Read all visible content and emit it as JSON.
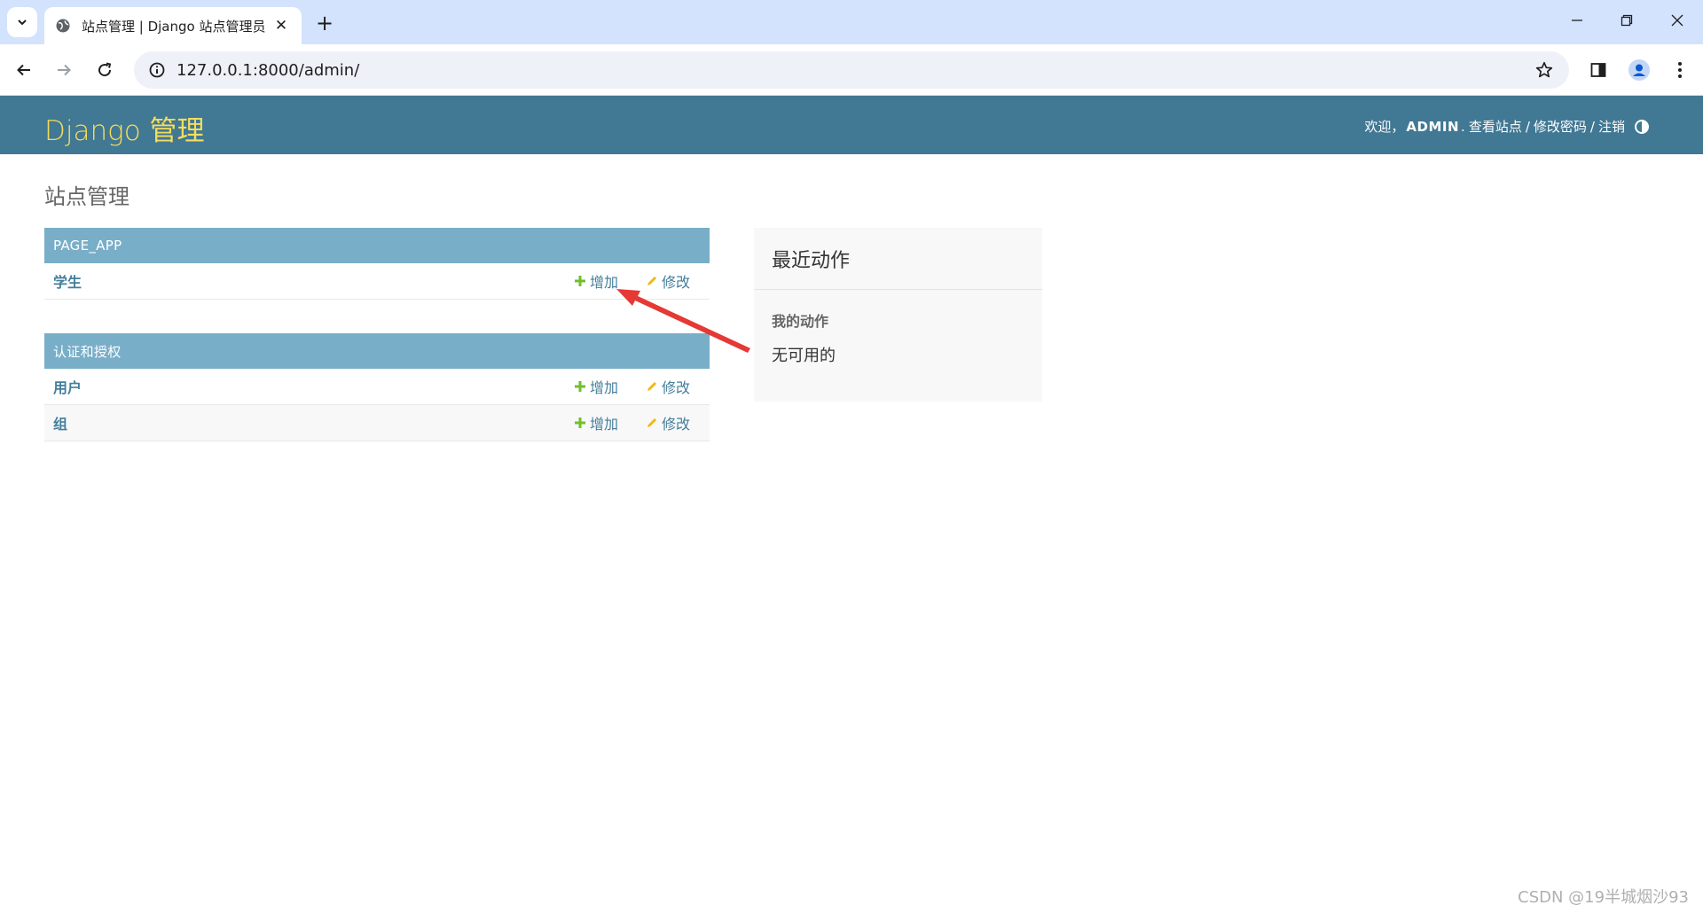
{
  "browser": {
    "tab_title": "站点管理 | Django 站点管理员",
    "url": "127.0.0.1:8000/admin/",
    "close_glyph": "✕",
    "new_tab_glyph": "+"
  },
  "header": {
    "branding": "Django 管理",
    "welcome": "欢迎，",
    "username": "ADMIN",
    "dot": ".",
    "view_site": "查看站点",
    "sep": "/",
    "change_password": "修改密码",
    "logout": "注销"
  },
  "content": {
    "title": "站点管理"
  },
  "apps": [
    {
      "caption": "PAGE_APP",
      "models": [
        {
          "name": "学生",
          "add": "增加",
          "change": "修改"
        }
      ]
    },
    {
      "caption": "认证和授权",
      "models": [
        {
          "name": "用户",
          "add": "增加",
          "change": "修改"
        },
        {
          "name": "组",
          "add": "增加",
          "change": "修改"
        }
      ]
    }
  ],
  "recent_actions": {
    "title": "最近动作",
    "subtitle": "我的动作",
    "empty": "无可用的"
  },
  "annotation": {
    "color": "#e53935"
  },
  "watermark": "CSDN @19半城烟沙93"
}
